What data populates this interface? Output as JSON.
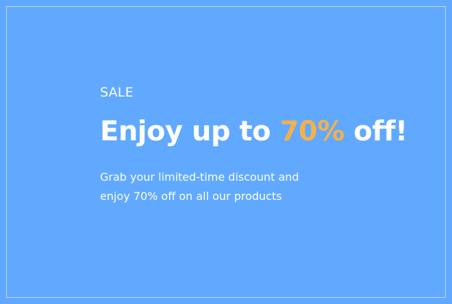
{
  "banner": {
    "eyebrow": "SALE",
    "headline_before": "Enjoy up to ",
    "headline_highlight": "70%",
    "headline_after": " off!",
    "body": "Grab your limited-time discount and enjoy 70% off on all our products"
  },
  "colors": {
    "background": "#60a9ff",
    "text": "#ffffff",
    "accent": "#f3b14d"
  }
}
